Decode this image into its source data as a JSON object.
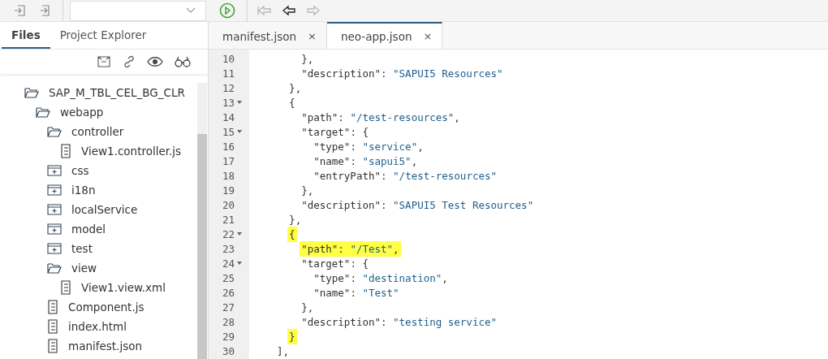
{
  "toolbar": {
    "nav_buttons": [
      {
        "kind": "back-all",
        "disabled": true
      },
      {
        "kind": "back",
        "disabled": false
      },
      {
        "kind": "forward",
        "disabled": true
      }
    ]
  },
  "side_tabs": [
    {
      "label": "Files",
      "selected": true
    },
    {
      "label": "Project Explorer",
      "selected": false
    }
  ],
  "tree": [
    {
      "name": "SAP_M_TBL_CEL_BG_CLR",
      "kind": "folder",
      "expanded": true,
      "children": [
        {
          "name": "webapp",
          "kind": "folder",
          "expanded": true,
          "children": [
            {
              "name": "controller",
              "kind": "folder",
              "expanded": true,
              "children": [
                {
                  "name": "View1.controller.js",
                  "kind": "file"
                }
              ]
            },
            {
              "name": "css",
              "kind": "folder",
              "expanded": false
            },
            {
              "name": "i18n",
              "kind": "folder",
              "expanded": false
            },
            {
              "name": "localService",
              "kind": "folder",
              "expanded": false
            },
            {
              "name": "model",
              "kind": "folder",
              "expanded": false
            },
            {
              "name": "test",
              "kind": "folder",
              "expanded": false
            },
            {
              "name": "view",
              "kind": "folder",
              "expanded": true,
              "children": [
                {
                  "name": "View1.view.xml",
                  "kind": "file"
                }
              ]
            },
            {
              "name": "Component.js",
              "kind": "file"
            },
            {
              "name": "index.html",
              "kind": "file"
            },
            {
              "name": "manifest.json",
              "kind": "file"
            }
          ]
        }
      ]
    }
  ],
  "editor_tabs": [
    {
      "label": "manifest.json",
      "close": "×",
      "selected": false
    },
    {
      "label": "neo-app.json",
      "close": "×",
      "selected": true
    }
  ],
  "code_lines": [
    {
      "number": "10",
      "text": "      },",
      "foldable": false,
      "highlighted": false
    },
    {
      "number": "11",
      "text": "      \"description\": \"SAPUI5 Resources\"",
      "foldable": false,
      "highlighted": false
    },
    {
      "number": "12",
      "text": "    },",
      "foldable": false,
      "highlighted": false
    },
    {
      "number": "13",
      "text": "    {",
      "foldable": true,
      "highlighted": false
    },
    {
      "number": "14",
      "text": "      \"path\": \"/test-resources\",",
      "foldable": false,
      "highlighted": false
    },
    {
      "number": "15",
      "text": "      \"target\": {",
      "foldable": true,
      "highlighted": false
    },
    {
      "number": "16",
      "text": "        \"type\": \"service\",",
      "foldable": false,
      "highlighted": false
    },
    {
      "number": "17",
      "text": "        \"name\": \"sapui5\",",
      "foldable": false,
      "highlighted": false
    },
    {
      "number": "18",
      "text": "        \"entryPath\": \"/test-resources\"",
      "foldable": false,
      "highlighted": false
    },
    {
      "number": "19",
      "text": "      },",
      "foldable": false,
      "highlighted": false
    },
    {
      "number": "20",
      "text": "      \"description\": \"SAPUI5 Test Resources\"",
      "foldable": false,
      "highlighted": false
    },
    {
      "number": "21",
      "text": "    },",
      "foldable": false,
      "highlighted": false
    },
    {
      "number": "22",
      "text": "    {",
      "foldable": true,
      "highlighted": true
    },
    {
      "number": "23",
      "text": "      \"path\": \"/Test\",",
      "foldable": false,
      "highlighted": true
    },
    {
      "number": "24",
      "text": "      \"target\": {",
      "foldable": true,
      "highlighted": false
    },
    {
      "number": "25",
      "text": "        \"type\": \"destination\",",
      "foldable": false,
      "highlighted": false
    },
    {
      "number": "26",
      "text": "        \"name\": \"Test\"",
      "foldable": false,
      "highlighted": false
    },
    {
      "number": "27",
      "text": "      },",
      "foldable": false,
      "highlighted": false
    },
    {
      "number": "28",
      "text": "      \"description\": \"testing service\"",
      "foldable": false,
      "highlighted": false
    },
    {
      "number": "29",
      "text": "    }",
      "foldable": false,
      "highlighted": true
    },
    {
      "number": "30",
      "text": "  ],",
      "foldable": false,
      "highlighted": false
    }
  ]
}
